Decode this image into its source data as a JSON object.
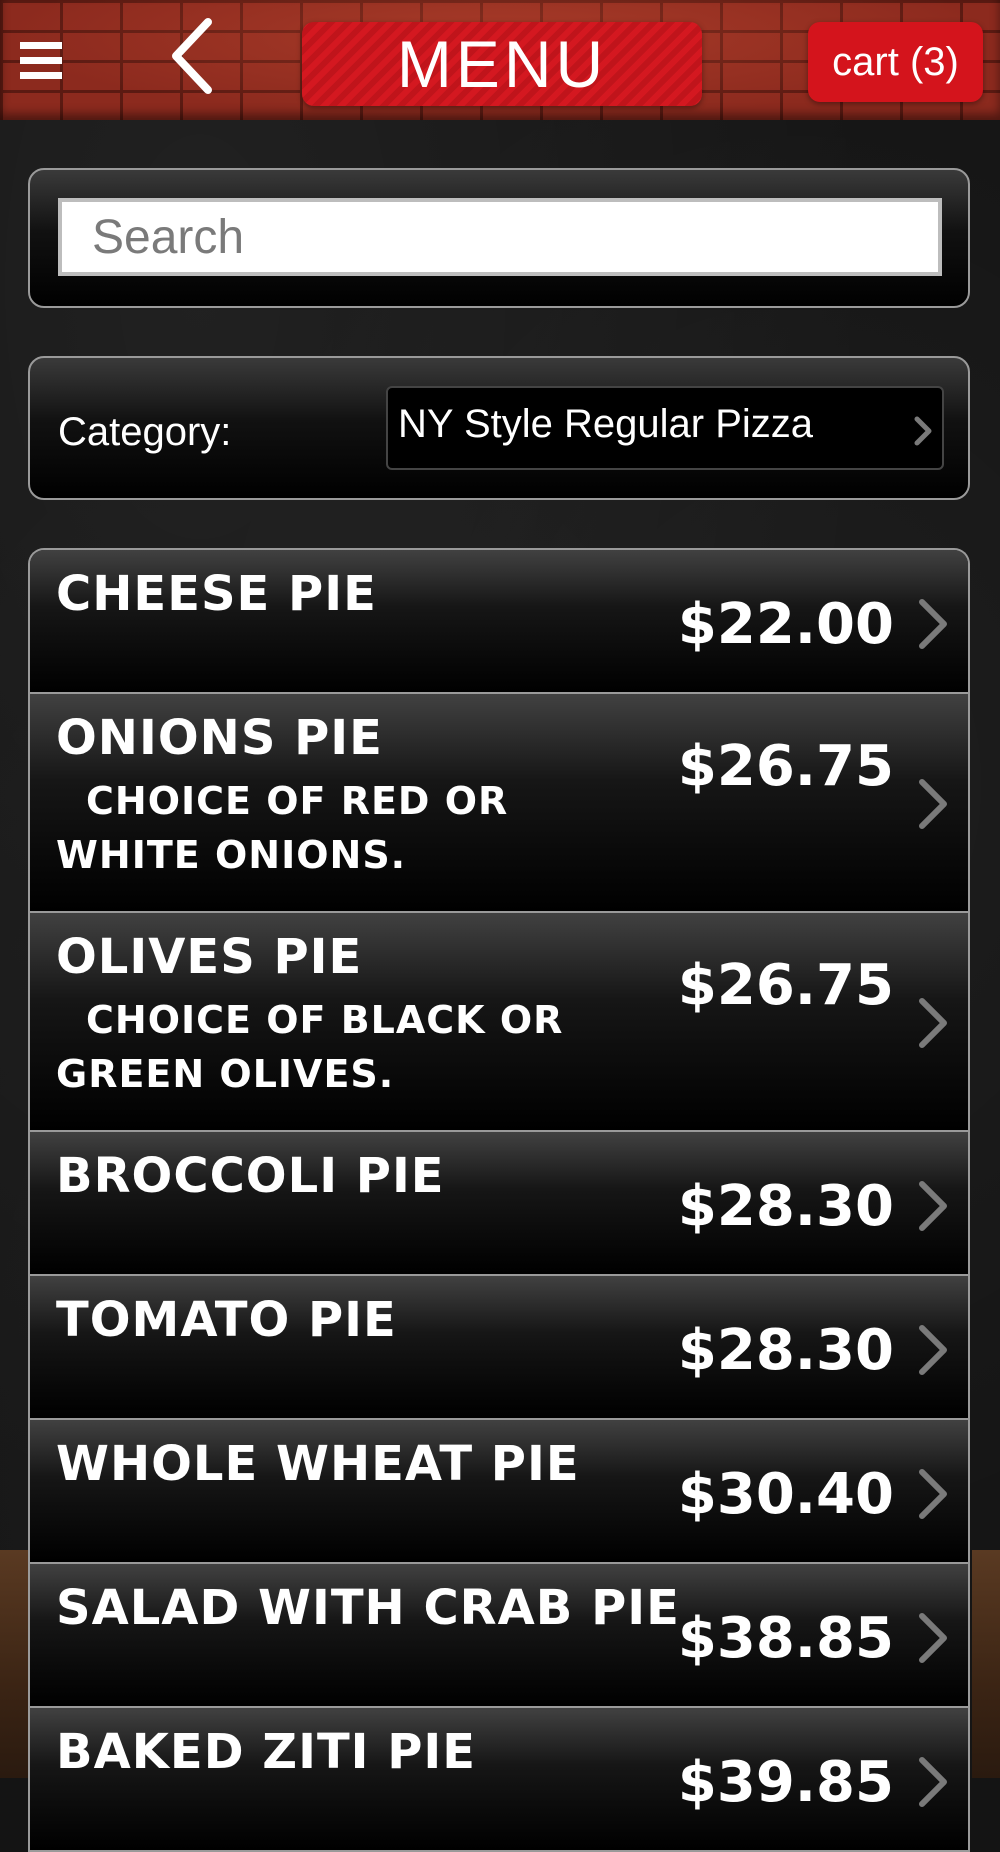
{
  "header": {
    "title": "MENU",
    "cart_label": "cart (3)"
  },
  "search": {
    "placeholder": "Search",
    "value": ""
  },
  "category": {
    "label": "Category:",
    "selected": "NY Style Regular Pizza"
  },
  "items": [
    {
      "name": "CHEESE PIE",
      "description": "",
      "price": "$22.00"
    },
    {
      "name": "ONIONS PIE",
      "description": "CHOICE OF RED OR WHITE ONIONS.",
      "price": "$26.75"
    },
    {
      "name": "OLIVES PIE",
      "description": "CHOICE OF BLACK OR GREEN OLIVES.",
      "price": "$26.75"
    },
    {
      "name": "BROCCOLI PIE",
      "description": "",
      "price": "$28.30"
    },
    {
      "name": "TOMATO PIE",
      "description": "",
      "price": "$28.30"
    },
    {
      "name": "WHOLE WHEAT PIE",
      "description": "",
      "price": "$30.40"
    },
    {
      "name": "SALAD WITH CRAB PIE",
      "description": "",
      "price": "$38.85"
    },
    {
      "name": "BAKED ZITI PIE",
      "description": "",
      "price": "$39.85"
    }
  ],
  "colors": {
    "accent_red": "#d4141c",
    "background": "#151515",
    "text": "#ffffff"
  },
  "icons": {
    "menu": "hamburger-icon",
    "back": "chevron-left-icon",
    "disclosure": "chevron-right-icon"
  }
}
